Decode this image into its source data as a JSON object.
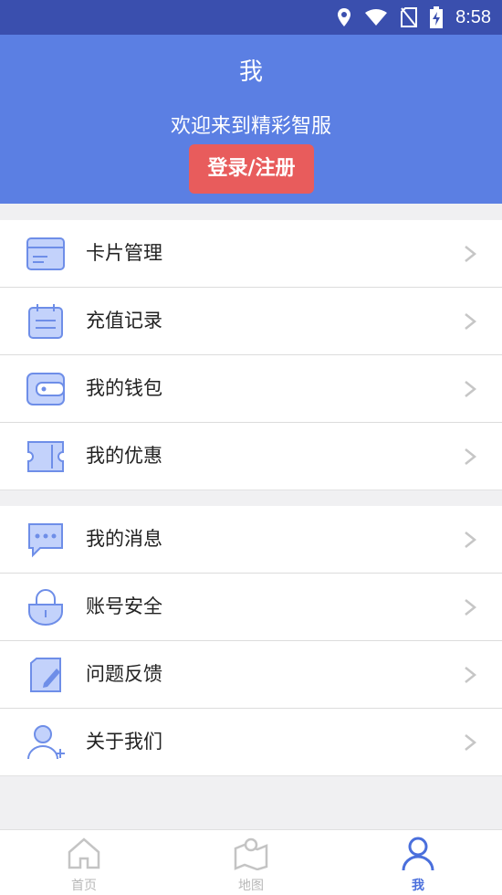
{
  "status_bar": {
    "time": "8:58",
    "icons": [
      "location-icon",
      "wifi-icon",
      "no-sim-icon",
      "battery-charging-icon"
    ]
  },
  "header": {
    "title": "我",
    "welcome": "欢迎来到精彩智服",
    "login_label": "登录/注册"
  },
  "colors": {
    "status_bar": "#3a4fae",
    "header": "#5b7fe3",
    "login": "#e85c5c",
    "accent": "#4a6fdc",
    "icon_fill": "#c3d2fb"
  },
  "menu_group_1": [
    {
      "label": "卡片管理",
      "icon": "card-icon"
    },
    {
      "label": "充值记录",
      "icon": "calendar-record-icon"
    },
    {
      "label": "我的钱包",
      "icon": "wallet-icon"
    },
    {
      "label": "我的优惠",
      "icon": "coupon-icon"
    }
  ],
  "menu_group_2": [
    {
      "label": "我的消息",
      "icon": "message-icon"
    },
    {
      "label": "账号安全",
      "icon": "lock-icon"
    },
    {
      "label": "问题反馈",
      "icon": "feedback-icon"
    },
    {
      "label": "关于我们",
      "icon": "about-user-icon"
    }
  ],
  "tabbar": [
    {
      "label": "首页",
      "icon": "home-icon",
      "active": false
    },
    {
      "label": "地图",
      "icon": "map-icon",
      "active": false
    },
    {
      "label": "我",
      "icon": "profile-icon",
      "active": true
    }
  ]
}
